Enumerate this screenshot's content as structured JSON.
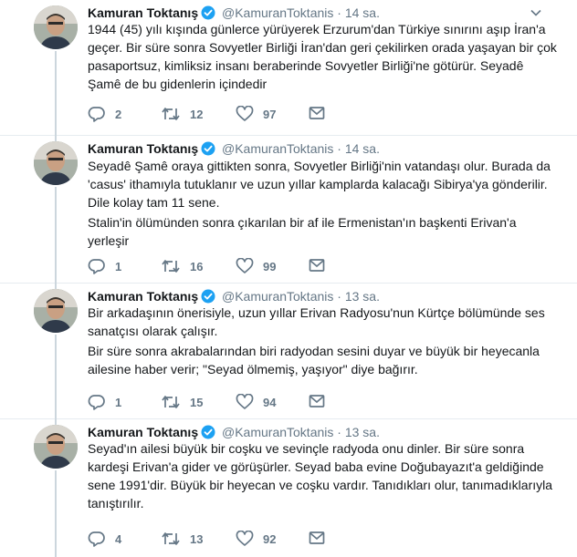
{
  "tweets": [
    {
      "name": "Kamuran Toktanış",
      "handle": "@KamuranToktanis",
      "time": "14 sa.",
      "paragraphs": [
        "1944 (45) yılı kışında günlerce yürüyerek Erzurum'dan Türkiye sınırını aşıp İran'a geçer. Bir süre sonra Sovyetler Birliği İran'dan geri çekilirken orada yaşayan bir çok pasaportsuz, kimliksiz insanı beraberinde Sovyetler Birliği'ne götürür. Seyadê Şamê de bu gidenlerin içindedir"
      ],
      "replies": "2",
      "retweets": "12",
      "likes": "97"
    },
    {
      "name": "Kamuran Toktanış",
      "handle": "@KamuranToktanis",
      "time": "14 sa.",
      "paragraphs": [
        "Seyadê Şamê oraya gittikten sonra, Sovyetler Birliği'nin vatandaşı olur. Burada da 'casus' ithamıyla tutuklanır ve uzun yıllar kamplarda kalacağı Sibirya'ya gönderilir. Dile kolay tam 11 sene.",
        "Stalin'in ölümünden sonra çıkarılan bir af ile Ermenistan'ın başkenti Erivan'a yerleşir"
      ],
      "replies": "1",
      "retweets": "16",
      "likes": "99"
    },
    {
      "name": "Kamuran Toktanış",
      "handle": "@KamuranToktanis",
      "time": "13 sa.",
      "paragraphs": [
        "Bir arkadaşının önerisiyle, uzun yıllar Erivan Radyosu'nun Kürtçe bölümünde ses sanatçısı olarak çalışır.",
        "Bir süre sonra akrabalarından biri radyodan sesini duyar ve büyük bir heyecanla ailesine haber verir; \"Seyad ölmemiş, yaşıyor\" diye bağırır."
      ],
      "replies": "1",
      "retweets": "15",
      "likes": "94"
    },
    {
      "name": "Kamuran Toktanış",
      "handle": "@KamuranToktanis",
      "time": "13 sa.",
      "paragraphs": [
        "Seyad'ın ailesi büyük bir coşku ve sevinçle radyoda onu dinler. Bir süre sonra kardeşi Erivan'a gider ve görüşürler. Seyad baba evine Doğubayazıt'a geldiğinde sene 1991'dir. Büyük bir heyecan ve coşku vardır. Tanıdıkları olur, tanımadıklarıyla tanıştırılır."
      ],
      "replies": "4",
      "retweets": "13",
      "likes": "92"
    }
  ],
  "separator": "·",
  "colors": {
    "verified": "#1da1f2",
    "muted": "#657786",
    "text": "#14171a",
    "thread": "#ccd6dd"
  }
}
